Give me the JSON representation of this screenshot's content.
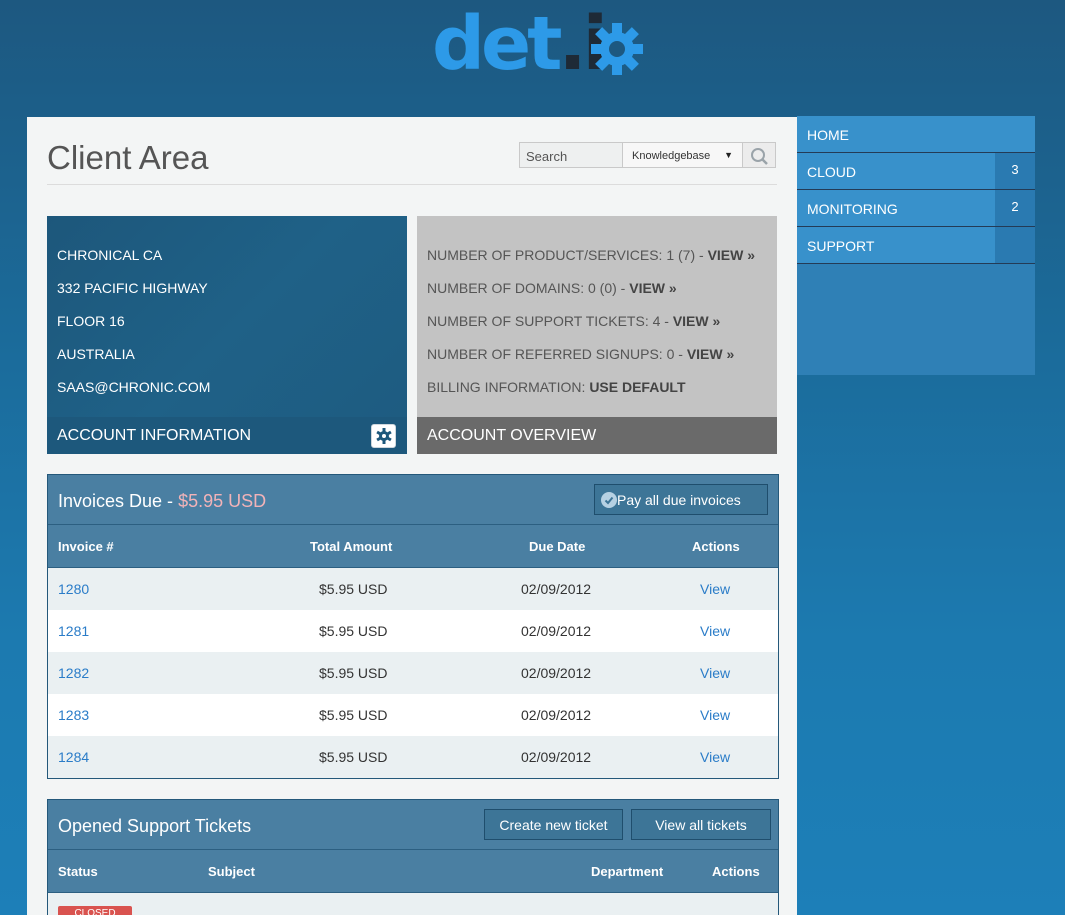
{
  "logo": {
    "part1": "det",
    "part2": ".i"
  },
  "page_title": "Client Area",
  "search": {
    "placeholder": "Search",
    "scope": "Knowledgebase"
  },
  "account_info": {
    "lines": [
      "CHRONICAL CA",
      "332 PACIFIC HIGHWAY",
      "FLOOR 16",
      "AUSTRALIA",
      "SAAS@CHRONIC.COM"
    ],
    "footer": "ACCOUNT INFORMATION"
  },
  "account_overview": {
    "lines": [
      {
        "label": "NUMBER OF PRODUCT/SERVICES: 1 (7) - ",
        "link": "VIEW »"
      },
      {
        "label": "NUMBER OF DOMAINS: 0 (0) - ",
        "link": "VIEW »"
      },
      {
        "label": "NUMBER OF SUPPORT TICKETS: 4 - ",
        "link": "VIEW »"
      },
      {
        "label": "NUMBER OF REFERRED SIGNUPS: 0 - ",
        "link": "VIEW »"
      },
      {
        "label": "BILLING INFORMATION: ",
        "link": "USE DEFAULT"
      }
    ],
    "footer": "ACCOUNT OVERVIEW"
  },
  "invoices": {
    "title": "Invoices Due - ",
    "amount": "$5.95 USD",
    "pay_all": "Pay all due invoices",
    "columns": [
      "Invoice #",
      "Total Amount",
      "Due Date",
      "Actions"
    ],
    "rows": [
      {
        "id": "1280",
        "amount": "$5.95 USD",
        "due": "02/09/2012",
        "action": "View"
      },
      {
        "id": "1281",
        "amount": "$5.95 USD",
        "due": "02/09/2012",
        "action": "View"
      },
      {
        "id": "1282",
        "amount": "$5.95 USD",
        "due": "02/09/2012",
        "action": "View"
      },
      {
        "id": "1283",
        "amount": "$5.95 USD",
        "due": "02/09/2012",
        "action": "View"
      },
      {
        "id": "1284",
        "amount": "$5.95 USD",
        "due": "02/09/2012",
        "action": "View"
      }
    ]
  },
  "tickets": {
    "title": "Opened Support Tickets",
    "create_btn": "Create new ticket",
    "view_all_btn": "View all tickets",
    "columns": [
      "Status",
      "Subject",
      "Department",
      "Actions"
    ],
    "first_row": {
      "status": "CLOSED"
    }
  },
  "sidebar": {
    "items": [
      {
        "label": "HOME",
        "count": ""
      },
      {
        "label": "CLOUD",
        "count": "3"
      },
      {
        "label": "MONITORING",
        "count": "2"
      },
      {
        "label": "SUPPORT",
        "count": ""
      }
    ]
  },
  "colors": {
    "accent": "#3891cb",
    "brand_blue": "#2d9ae8",
    "closed_badge": "#d9534f"
  }
}
